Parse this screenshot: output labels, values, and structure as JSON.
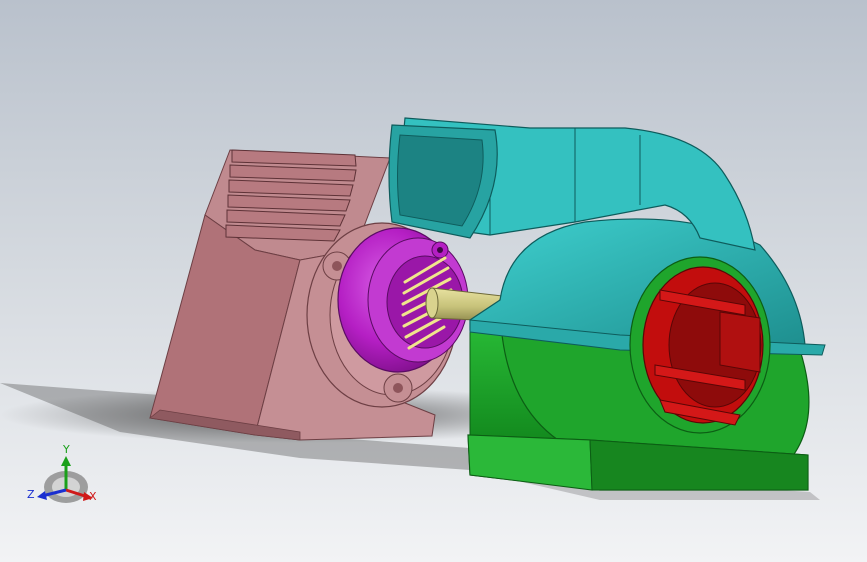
{
  "viewport": {
    "background_top": "#b9c1cc",
    "background_bottom": "#f2f3f5"
  },
  "model": {
    "parts": [
      {
        "name": "motor-housing",
        "color": "#b77a80"
      },
      {
        "name": "motor-flange",
        "color": "#c58f94"
      },
      {
        "name": "end-cap",
        "color": "#b51fc4"
      },
      {
        "name": "shaft",
        "color": "#c7c27a"
      },
      {
        "name": "volute-cover",
        "color": "#2fb2b2"
      },
      {
        "name": "outlet-duct",
        "color": "#34c1c0"
      },
      {
        "name": "impeller",
        "color": "#c20d0d"
      },
      {
        "name": "base-casing",
        "color": "#1fa52c"
      }
    ]
  },
  "triad": {
    "y_label": "Y",
    "z_label": "Z",
    "x_label": "X",
    "y_color": "#1aa01a",
    "z_color": "#1a2fd0",
    "x_color": "#d01a1a"
  }
}
